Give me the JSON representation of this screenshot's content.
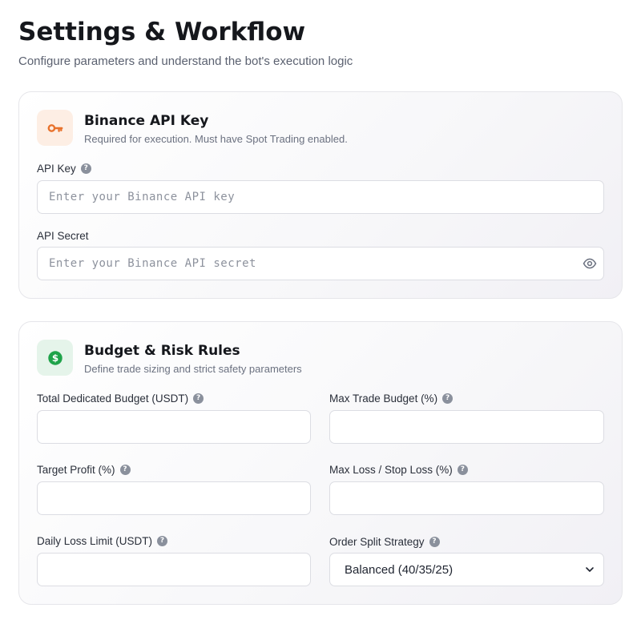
{
  "header": {
    "title": "Settings & Workflow",
    "subtitle": "Configure parameters and understand the bot's execution logic"
  },
  "api_card": {
    "icon": "key-icon",
    "accent": "#e8722c",
    "title": "Binance API Key",
    "subtitle": "Required for execution. Must have Spot Trading enabled.",
    "api_key": {
      "label": "API Key",
      "placeholder": "Enter your Binance API key",
      "value": ""
    },
    "api_secret": {
      "label": "API Secret",
      "placeholder": "Enter your Binance API secret",
      "value": ""
    }
  },
  "budget_card": {
    "icon": "dollar-icon",
    "accent": "#1fa34a",
    "title": "Budget & Risk Rules",
    "subtitle": "Define trade sizing and strict safety parameters",
    "fields": {
      "total_budget": {
        "label": "Total Dedicated Budget (USDT)",
        "value": ""
      },
      "max_trade_budget": {
        "label": "Max Trade Budget (%)",
        "value": ""
      },
      "target_profit": {
        "label": "Target Profit (%)",
        "value": ""
      },
      "max_loss": {
        "label": "Max Loss / Stop Loss (%)",
        "value": ""
      },
      "daily_loss_limit": {
        "label": "Daily Loss Limit (USDT)",
        "value": ""
      },
      "order_split": {
        "label": "Order Split Strategy",
        "selected": "Balanced (40/35/25)"
      }
    }
  },
  "help_glyph": "?"
}
